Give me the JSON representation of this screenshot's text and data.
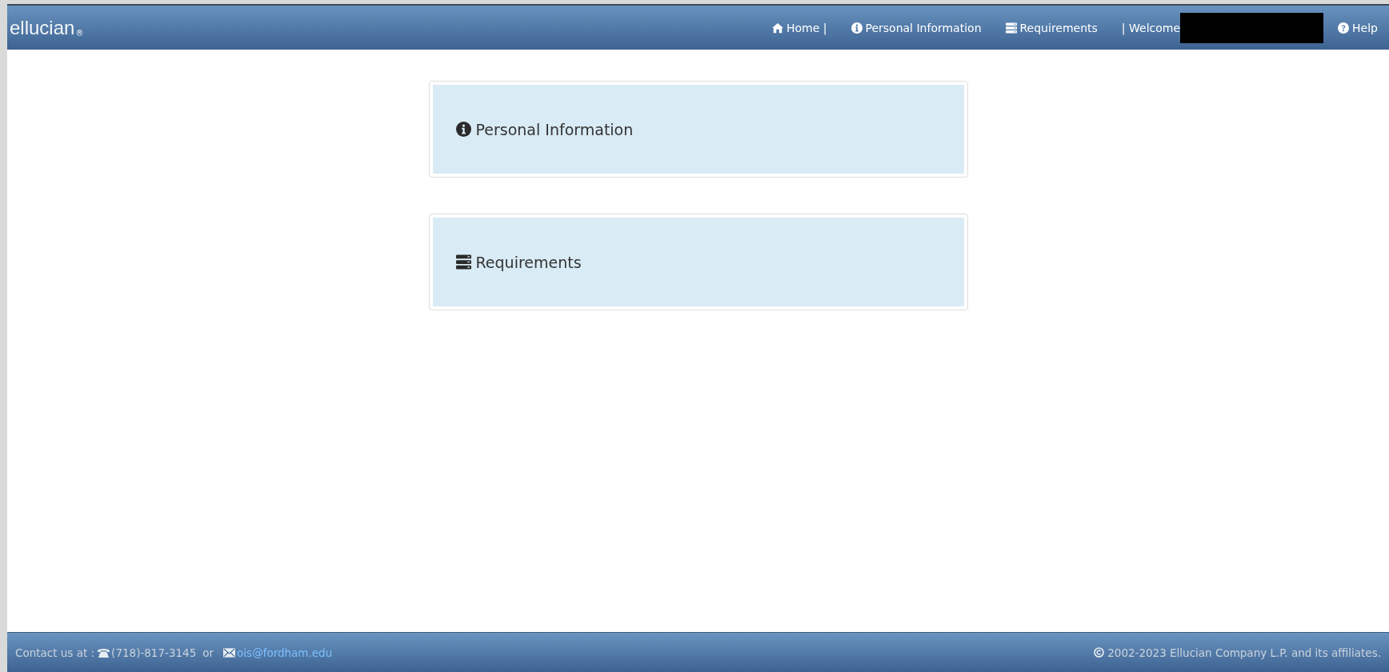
{
  "header": {
    "logo": {
      "text": "ellucian",
      "mark": "®"
    },
    "nav": [
      {
        "kind": "home",
        "label": "Home |"
      },
      {
        "kind": "info",
        "label": "Personal Information"
      },
      {
        "kind": "server",
        "label": "Requirements"
      }
    ],
    "welcome": {
      "label": "| Welcome",
      "redacted": true
    },
    "help": {
      "kind": "question",
      "label": "Help"
    }
  },
  "cards": [
    {
      "kind": "info",
      "label": "Personal Information"
    },
    {
      "kind": "server",
      "label": "Requirements"
    }
  ],
  "footer": {
    "contact_label": "Contact us at :",
    "phone": "(718)-817-3145",
    "or": "or",
    "email": "ois@fordham.edu",
    "copyright": "2002-2023 Ellucian Company L.P. and its affiliates."
  }
}
